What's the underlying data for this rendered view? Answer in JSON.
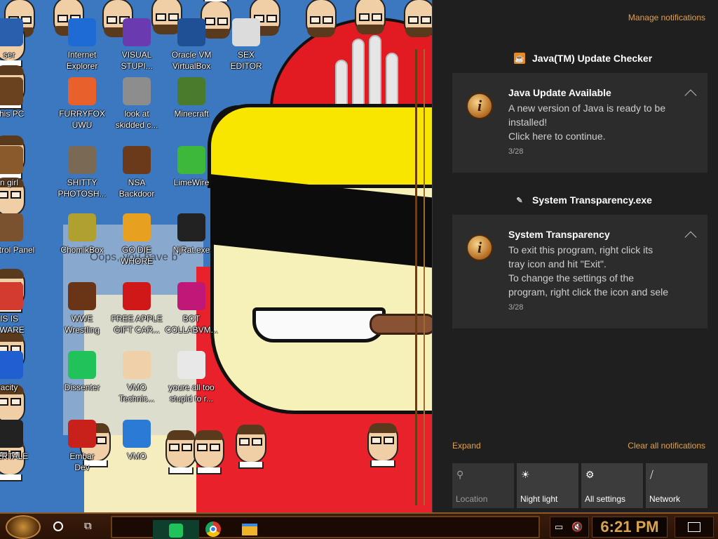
{
  "desktop": {
    "icons": [
      {
        "label": "ser",
        "icon": "browser-icon",
        "color": "#2a5fae"
      },
      {
        "label": "Internet\nExplorer",
        "icon": "internet-explorer-icon",
        "color": "#1e6bd6"
      },
      {
        "label": "VISUAL\nSTUPI...",
        "icon": "visual-studio-icon",
        "color": "#6a3ab0"
      },
      {
        "label": "Oracle VM\nVirtualBox",
        "icon": "virtualbox-icon",
        "color": "#1f4f95"
      },
      {
        "label": "SEX\nEDITOR",
        "icon": "hex-editor-icon",
        "color": "#dcdcdc"
      },
      {
        "label": "This PC",
        "icon": "computer-icon",
        "color": "#6b4220"
      },
      {
        "label": "FURRYFOX\nUWU",
        "icon": "firefox-icon",
        "color": "#e8602a"
      },
      {
        "label": "look at\nskidded c...",
        "icon": "copy-icon",
        "color": "#8d8d8d"
      },
      {
        "label": "Minecraft",
        "icon": "minecraft-icon",
        "color": "#4a7a2c"
      },
      {
        "label": "n girl",
        "icon": "folder-icon",
        "color": "#8a5a2a"
      },
      {
        "label": "SHITTY\nPHOTOSH...",
        "icon": "gimp-icon",
        "color": "#7a6a55"
      },
      {
        "label": "NSA\nBackdoor",
        "icon": "picture-frame-icon",
        "color": "#6b3a1a"
      },
      {
        "label": "LimeWire",
        "icon": "limewire-icon",
        "color": "#3db83a"
      },
      {
        "label": "Control Panel",
        "icon": "lightbulb-icon",
        "color": "#7a5230"
      },
      {
        "label": "ChomikBox",
        "icon": "chomikbox-icon",
        "color": "#b0a030"
      },
      {
        "label": "GO DIE\nWHORE",
        "icon": "de-icon",
        "color": "#e8a020"
      },
      {
        "label": "NjRat.exe",
        "icon": "skull-icon",
        "color": "#222222"
      },
      {
        "label": "IS IS\nYWARE",
        "icon": "chrome-icon",
        "color": "#d23b2e"
      },
      {
        "label": "WWE\nWrestling",
        "icon": "tv-cabinet-icon",
        "color": "#6a3416"
      },
      {
        "label": "FREE APPLE\nGIFT CAR...",
        "icon": "apple-icon",
        "color": "#d01818"
      },
      {
        "label": "BOT\nCOLLABVM...",
        "icon": "monitor-icon",
        "color": "#c01878"
      },
      {
        "label": "acity",
        "icon": "audacity-icon",
        "color": "#1f5fd0"
      },
      {
        "label": "Dissenter",
        "icon": "dissenter-icon",
        "color": "#22c25a"
      },
      {
        "label": "VMO\nTechnic...",
        "icon": "doctor-icon",
        "color": "#f0d0a8"
      },
      {
        "label": "youre all too\nstupid to r...",
        "icon": "sketch-face-icon",
        "color": "#e8e8e8"
      },
      {
        "label": "DERTALE",
        "icon": "unity-icon",
        "color": "#222222"
      },
      {
        "label": "Embar\nDev",
        "icon": "embarcadero-icon",
        "color": "#c8201a"
      },
      {
        "label": "VMO",
        "icon": "shield-icon",
        "color": "#2a7ad6"
      }
    ],
    "wallpaper_text": "Oops, you have b"
  },
  "action_center": {
    "manage_link": "Manage notifications",
    "groups": [
      {
        "app_name": "Java(TM) Update Checker",
        "app_icon": "java-icon",
        "toast": {
          "title": "Java Update Available",
          "body": "A new version of Java is ready to be\ninstalled!\nClick here to continue.",
          "date": "3/28",
          "icon": "info-icon",
          "glyph": "i"
        }
      },
      {
        "app_name": "System Transparency.exe",
        "app_icon": "feather-icon",
        "toast": {
          "title": "System Transparency",
          "body": "To exit this program, right click its\ntray icon and hit \"Exit\".\nTo change the settings of the\nprogram, right click the icon and sele",
          "date": "3/28",
          "icon": "info-icon",
          "glyph": "i"
        }
      }
    ],
    "expand_label": "Expand",
    "clear_label": "Clear all notifications",
    "quick_actions": [
      {
        "label": "Location",
        "icon": "location-icon",
        "glyph": "⚲",
        "enabled": false
      },
      {
        "label": "Night light",
        "icon": "sun-icon",
        "glyph": "☀",
        "enabled": true
      },
      {
        "label": "All settings",
        "icon": "gear-icon",
        "glyph": "⚙",
        "enabled": true
      },
      {
        "label": "Network",
        "icon": "network-icon",
        "glyph": "⧸",
        "enabled": true
      }
    ],
    "accent_color": "#e3a04a"
  },
  "taskbar": {
    "clock": "6:21 PM",
    "pinned": [
      {
        "name": "Dissenter",
        "icon": "dissenter-icon"
      },
      {
        "name": "Chrome",
        "icon": "chrome-icon"
      },
      {
        "name": "File Explorer",
        "icon": "folder-icon"
      }
    ]
  }
}
